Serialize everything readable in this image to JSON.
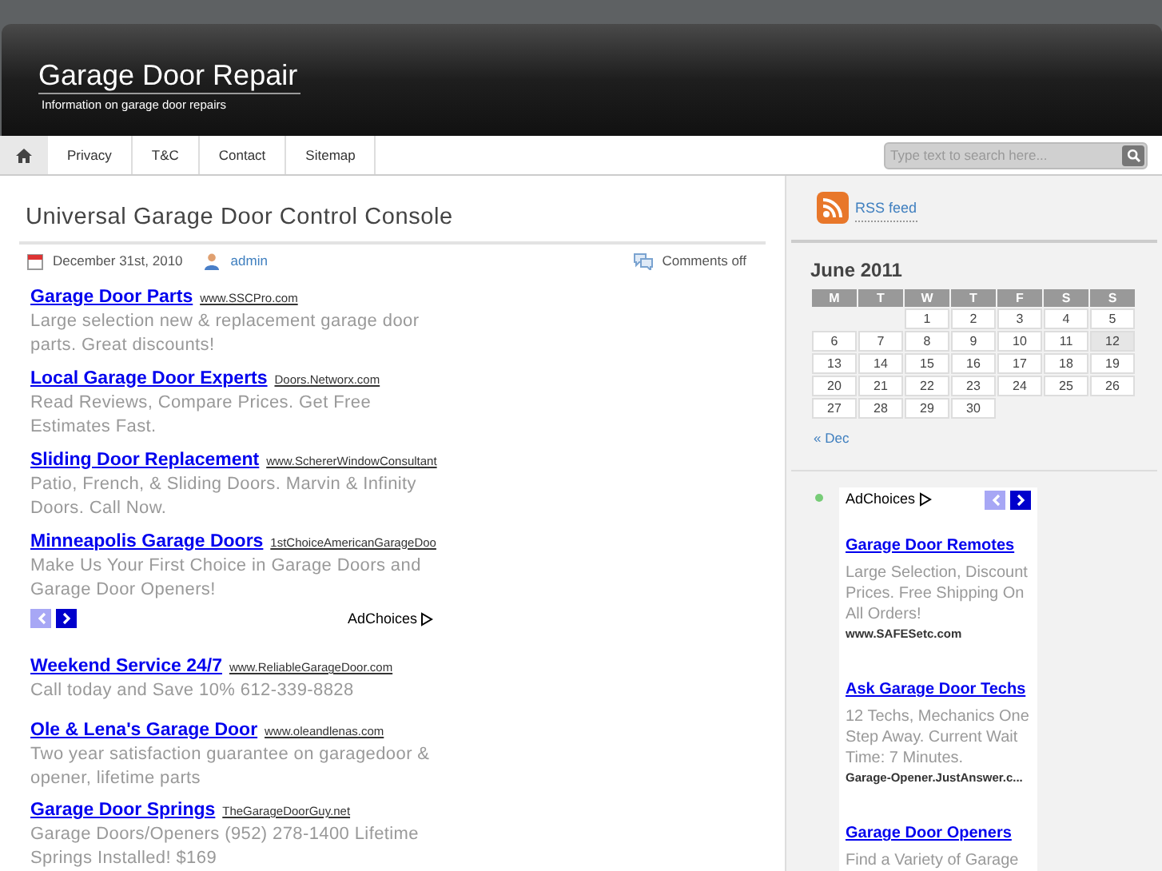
{
  "site": {
    "title": "Garage Door Repair",
    "tagline": "Information on garage door repairs"
  },
  "nav": {
    "home_selected": true,
    "items": [
      {
        "label": "Privacy",
        "selected": false
      },
      {
        "label": "T&C",
        "selected": false
      },
      {
        "label": "Contact",
        "selected": false
      },
      {
        "label": "Sitemap",
        "selected": false
      }
    ]
  },
  "search": {
    "placeholder": "Type text to search here..."
  },
  "post": {
    "title": "Universal Garage Door Control Console",
    "date": "December 31st, 2010",
    "author": "admin",
    "comments": "Comments off"
  },
  "ads_top": [
    {
      "title": "Garage Door Parts",
      "url": "www.SSCPro.com",
      "text": "Large selection new & replacement garage door parts. Great discounts!"
    },
    {
      "title": "Local Garage Door Experts",
      "url": "Doors.Networx.com",
      "text": "Read Reviews, Compare Prices. Get Free Estimates Fast."
    },
    {
      "title": "Sliding Door Replacement",
      "url": "www.SchererWindowConsultant",
      "text": "Patio, French, & Sliding Doors. Marvin & Infinity Doors. Call Now."
    },
    {
      "title": "Minneapolis Garage Doors",
      "url": "1stChoiceAmericanGarageDoo",
      "text": "Make Us Your First Choice in Garage Doors and Garage Door Openers!"
    }
  ],
  "ad_pager": {
    "prev_disabled": true,
    "next_disabled": false,
    "adchoices": "AdChoices"
  },
  "ads_bottom": [
    {
      "title": "Weekend Service 24/7",
      "url": "www.ReliableGarageDoor.com",
      "text": "Call today and Save 10% 612-339-8828"
    },
    {
      "title": "Ole & Lena's Garage Door",
      "url": "www.oleandlenas.com",
      "text": "Two year satisfaction guarantee on garagedoor & opener, lifetime parts"
    },
    {
      "title": "Garage Door Springs",
      "url": "TheGarageDoorGuy.net",
      "text": "Garage Doors/Openers (952) 278-1400 Lifetime Springs Installed! $169"
    }
  ],
  "sidebar": {
    "rss": "RSS feed",
    "calendar": {
      "caption": "June 2011",
      "days": [
        "M",
        "T",
        "W",
        "T",
        "F",
        "S",
        "S"
      ],
      "weeks": [
        [
          {
            "kind": "empty"
          },
          {
            "kind": "empty"
          },
          {
            "day": "1",
            "today": false
          },
          {
            "day": "2",
            "today": false
          },
          {
            "day": "3",
            "today": false
          },
          {
            "day": "4",
            "today": false
          },
          {
            "day": "5",
            "today": false
          }
        ],
        [
          {
            "day": "6",
            "today": false
          },
          {
            "day": "7",
            "today": false
          },
          {
            "day": "8",
            "today": false
          },
          {
            "day": "9",
            "today": false
          },
          {
            "day": "10",
            "today": false
          },
          {
            "day": "11",
            "today": false
          },
          {
            "day": "12",
            "today": true
          }
        ],
        [
          {
            "day": "13",
            "today": false
          },
          {
            "day": "14",
            "today": false
          },
          {
            "day": "15",
            "today": false
          },
          {
            "day": "16",
            "today": false
          },
          {
            "day": "17",
            "today": false
          },
          {
            "day": "18",
            "today": false
          },
          {
            "day": "19",
            "today": false
          }
        ],
        [
          {
            "day": "20",
            "today": false
          },
          {
            "day": "21",
            "today": false
          },
          {
            "day": "22",
            "today": false
          },
          {
            "day": "23",
            "today": false
          },
          {
            "day": "24",
            "today": false
          },
          {
            "day": "25",
            "today": false
          },
          {
            "day": "26",
            "today": false
          }
        ],
        [
          {
            "day": "27",
            "today": false
          },
          {
            "day": "28",
            "today": false
          },
          {
            "day": "29",
            "today": false
          },
          {
            "day": "30",
            "today": false
          },
          {
            "kind": "empty"
          },
          {
            "kind": "empty"
          },
          {
            "kind": "empty"
          }
        ]
      ],
      "prev": "« Dec"
    },
    "ad": {
      "adchoices": "AdChoices",
      "prev_disabled": true,
      "next_disabled": false,
      "items": [
        {
          "title": "Garage Door Remotes",
          "text": "Large Selection, Discount Prices. Free Shipping On All Orders!",
          "url": "www.SAFESetc.com"
        },
        {
          "title": "Ask Garage Door Techs",
          "text": "12 Techs, Mechanics One Step Away. Current Wait Time: 7 Minutes.",
          "url": "Garage-Opener.JustAnswer.c..."
        },
        {
          "title": "Garage Door Openers",
          "text": "Find a Variety of Garage"
        }
      ]
    }
  }
}
